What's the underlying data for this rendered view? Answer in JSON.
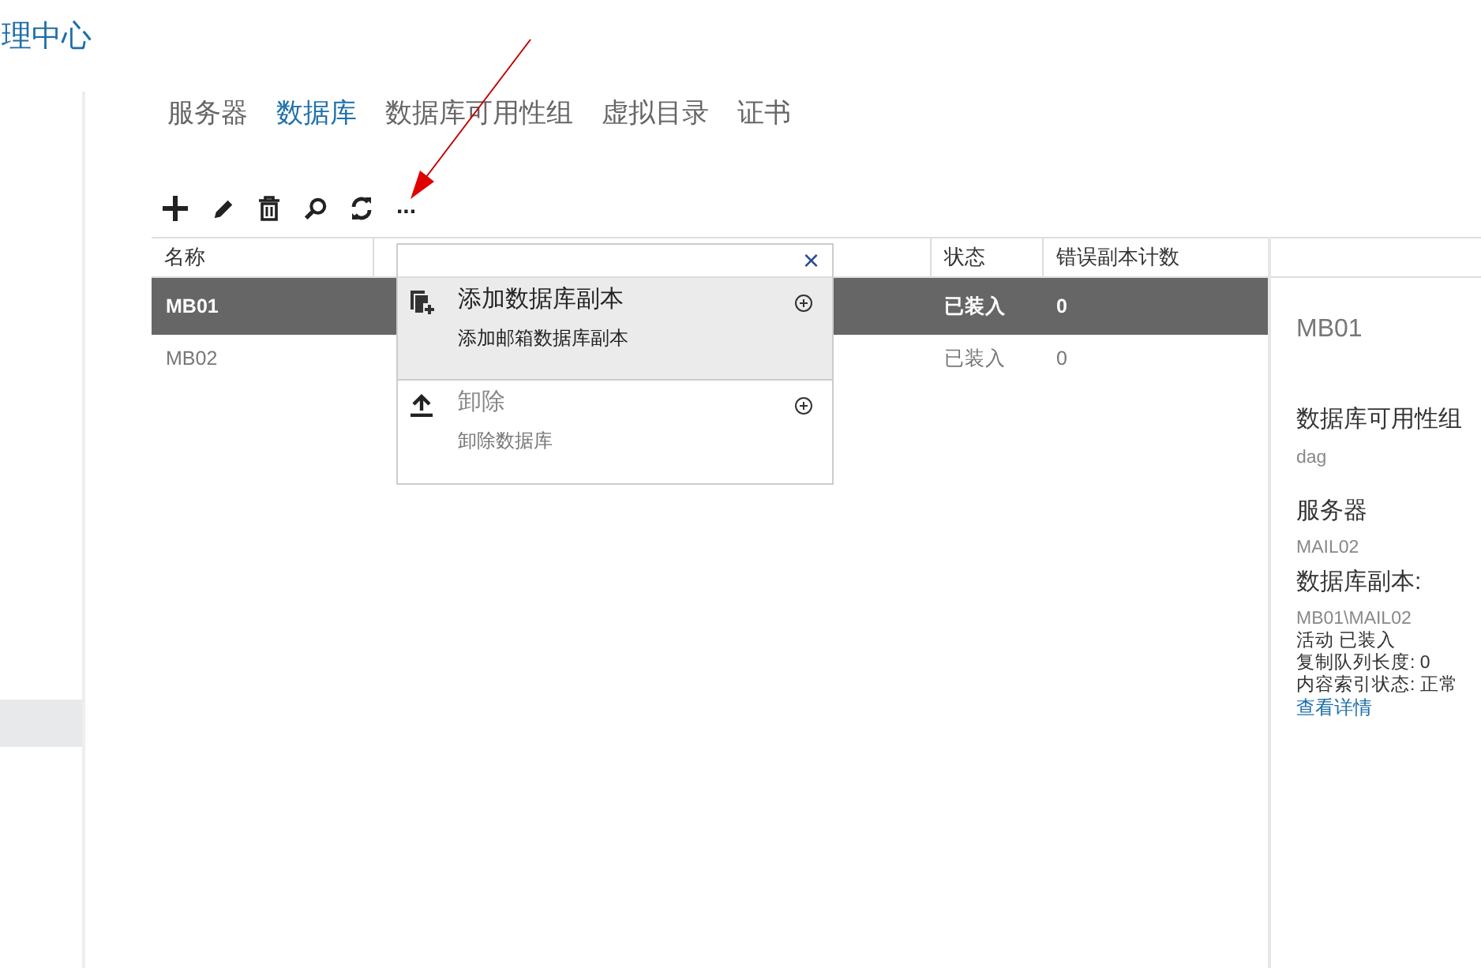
{
  "header": {
    "title": "理中心"
  },
  "left_nav": {
    "items": [
      {
        "selected": true
      }
    ]
  },
  "tabs": [
    {
      "label": "服务器",
      "selected": false
    },
    {
      "label": "数据库",
      "selected": true
    },
    {
      "label": "数据库可用性组",
      "selected": false
    },
    {
      "label": "虚拟目录",
      "selected": false
    },
    {
      "label": "证书",
      "selected": false
    }
  ],
  "toolbar": [
    {
      "kind": "add"
    },
    {
      "kind": "edit"
    },
    {
      "kind": "delete"
    },
    {
      "kind": "search"
    },
    {
      "kind": "refresh"
    },
    {
      "kind": "more",
      "label": "..."
    }
  ],
  "table": {
    "columns": [
      "名称",
      "状态",
      "错误副本计数"
    ],
    "rows": [
      {
        "name": "MB01",
        "status": "已装入",
        "errors": "0",
        "selected": true
      },
      {
        "name": "MB02",
        "status": "已装入",
        "errors": "0",
        "selected": false
      }
    ]
  },
  "menu": {
    "close": "×",
    "items": [
      {
        "kind": "copy",
        "title": "添加数据库副本",
        "description": "添加邮箱数据库副本",
        "highlighted": true,
        "disabled": false
      },
      {
        "kind": "upload",
        "title": "卸除",
        "description": "卸除数据库",
        "highlighted": false,
        "disabled": true
      }
    ]
  },
  "details": {
    "title": "MB01",
    "sections": [
      {
        "heading": "数据库可用性组",
        "lines": [
          "dag"
        ]
      },
      {
        "heading": "服务器",
        "lines": [
          "MAIL02"
        ]
      },
      {
        "heading": "数据库副本:",
        "lines": [
          "MB01\\MAIL02",
          "活动 已装入",
          "复制队列长度: 0",
          "内容索引状态: 正常"
        ],
        "link": "查看详情"
      }
    ]
  }
}
